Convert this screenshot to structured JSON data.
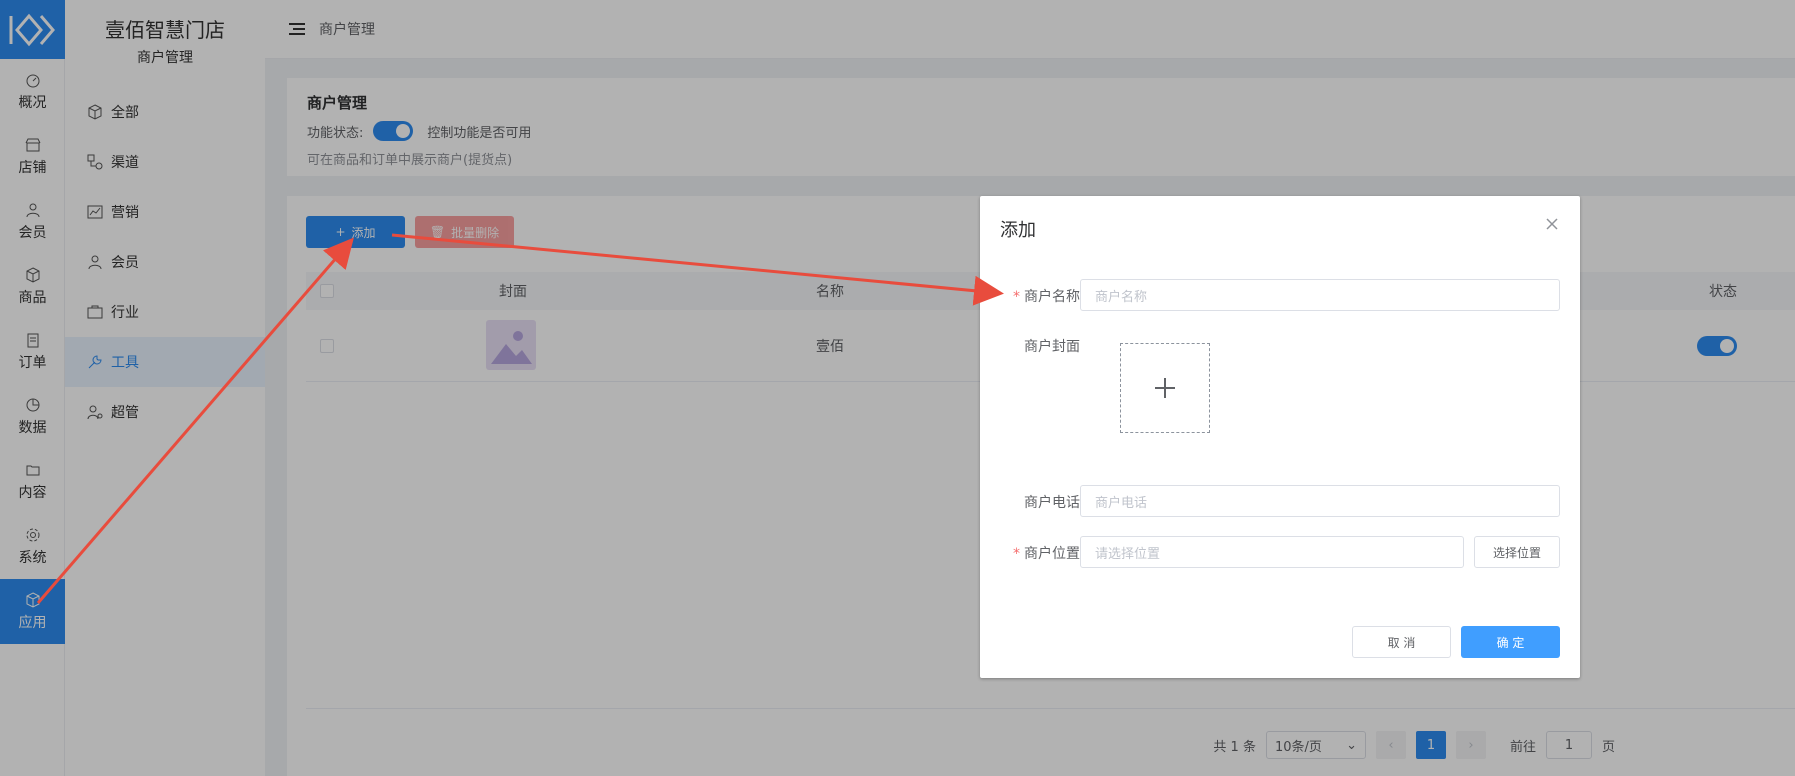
{
  "rail": {
    "items": [
      {
        "label": "概况"
      },
      {
        "label": "店铺"
      },
      {
        "label": "会员"
      },
      {
        "label": "商品"
      },
      {
        "label": "订单"
      },
      {
        "label": "数据"
      },
      {
        "label": "内容"
      },
      {
        "label": "系统"
      },
      {
        "label": "应用"
      }
    ]
  },
  "sidebar": {
    "title": "壹佰智慧门店",
    "subtitle": "商户管理",
    "items": [
      {
        "label": "全部"
      },
      {
        "label": "渠道"
      },
      {
        "label": "营销"
      },
      {
        "label": "会员"
      },
      {
        "label": "行业"
      },
      {
        "label": "工具"
      },
      {
        "label": "超管"
      }
    ]
  },
  "header": {
    "breadcrumb": "商户管理"
  },
  "main": {
    "section_title": "商户管理",
    "status_label": "功能状态:",
    "status_desc": "控制功能是否可用",
    "hint": "可在商品和订单中展示商户(提货点)",
    "add_label": "添加",
    "batch_delete_label": "批量删除",
    "columns": {
      "cover": "封面",
      "name": "名称",
      "status": "状态"
    },
    "row": {
      "name": "壹佰"
    },
    "pagination": {
      "total": "共 1 条",
      "page_size": "10条/页",
      "current": "1",
      "goto_label": "前往",
      "goto_value": "1",
      "page_unit": "页"
    }
  },
  "dialog": {
    "title": "添加",
    "name_label": "商户名称",
    "name_placeholder": "商户名称",
    "cover_label": "商户封面",
    "phone_label": "商户电话",
    "phone_placeholder": "商户电话",
    "location_label": "商户位置",
    "location_placeholder": "请选择位置",
    "pick_location_label": "选择位置",
    "cancel_label": "取 消",
    "ok_label": "确 定"
  },
  "colors": {
    "primary": "#2d8cf0",
    "danger": "#f56c6c",
    "arrow": "#e84c3d"
  }
}
